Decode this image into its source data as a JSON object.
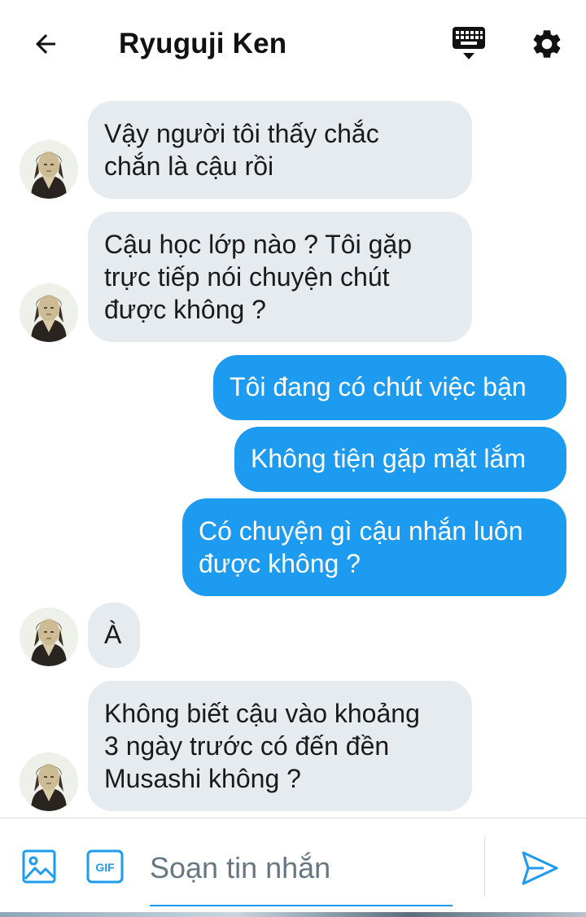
{
  "header": {
    "title": "Ryuguji Ken",
    "back_icon": "arrow-left-icon",
    "keyboard_icon": "keyboard-icon",
    "settings_icon": "gear-icon"
  },
  "messages": [
    {
      "direction": "incoming",
      "lines": [
        "Vậy người tôi thấy chắc",
        "chắn là cậu rồi"
      ]
    },
    {
      "direction": "incoming",
      "lines": [
        "Cậu học lớp nào ?  Tôi gặp",
        "trực tiếp nói chuyện chút",
        "được không ?"
      ]
    },
    {
      "direction": "outgoing",
      "lines": [
        "Tôi đang có chút việc bận"
      ]
    },
    {
      "direction": "outgoing",
      "lines": [
        "Không tiện gặp mặt lắm"
      ]
    },
    {
      "direction": "outgoing",
      "lines": [
        "Có chuyện gì cậu nhắn luôn",
        "được không ?"
      ]
    },
    {
      "direction": "incoming",
      "lines": [
        "À"
      ]
    },
    {
      "direction": "incoming",
      "lines": [
        "Không biết cậu vào khoảng",
        "3 ngày trước có đến đền",
        "Musashi không ?"
      ]
    }
  ],
  "composer": {
    "placeholder": "Soạn tin nhắn",
    "value": "",
    "gif_label": "GIF",
    "image_icon": "image-icon",
    "send_icon": "send-icon"
  },
  "colors": {
    "accent": "#1d9bf0",
    "incoming_bubble": "#e6ebef",
    "outgoing_text": "#ffffff"
  }
}
